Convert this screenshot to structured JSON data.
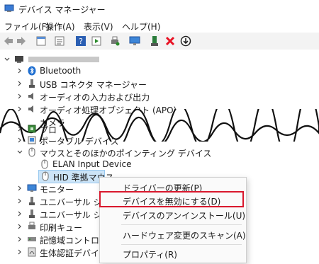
{
  "window": {
    "title": "デバイス マネージャー"
  },
  "menu": [
    "ファイル(F)",
    "操作(A)",
    "表示(V)",
    "ヘルプ(H)"
  ],
  "toolbar_icons": [
    "back-arrow-icon",
    "forward-arrow-icon",
    "properties-icon",
    "device-list-icon",
    "help-icon",
    "run-icon",
    "print-icon",
    "monitor-scan-icon",
    "update-driver-icon",
    "uninstall-icon",
    "download-icon"
  ],
  "tree": {
    "root_label": "",
    "items": [
      {
        "label": "Bluetooth"
      },
      {
        "label": "USB コネクタ マネージャー"
      },
      {
        "label": "オーディオの入力および出力"
      },
      {
        "label": "オーディオ処理オブジェクト (APO)"
      },
      {
        "label": "カメラ"
      },
      {
        "label": "プロ"
      },
      {
        "label": "ポータブル デバイス"
      },
      {
        "label": "マウスとそのほかのポインティング デバイス"
      },
      {
        "label": "ELAN Input Device"
      },
      {
        "label": "HID 準拠マウス"
      },
      {
        "label": "モニター"
      },
      {
        "label": "ユニバーサル シリアル"
      },
      {
        "label": "ユニバーサル シリアル"
      },
      {
        "label": "印刷キュー"
      },
      {
        "label": "記憶域コントローラー"
      },
      {
        "label": "生体認証デバイス"
      }
    ]
  },
  "context_menu": {
    "items": [
      {
        "label": "ドライバーの更新(P)"
      },
      {
        "label": "デバイスを無効にする(D)"
      },
      {
        "label": "デバイスのアンインストール(U)"
      },
      {
        "label": "ハードウェア変更のスキャン(A)"
      },
      {
        "label": "プロパティ(R)"
      }
    ]
  },
  "colors": {
    "highlight_border": "#d9182d",
    "selection": "#cce4f7",
    "accent_blue": "#1f6fd1",
    "uninstall_red": "#e81123"
  }
}
